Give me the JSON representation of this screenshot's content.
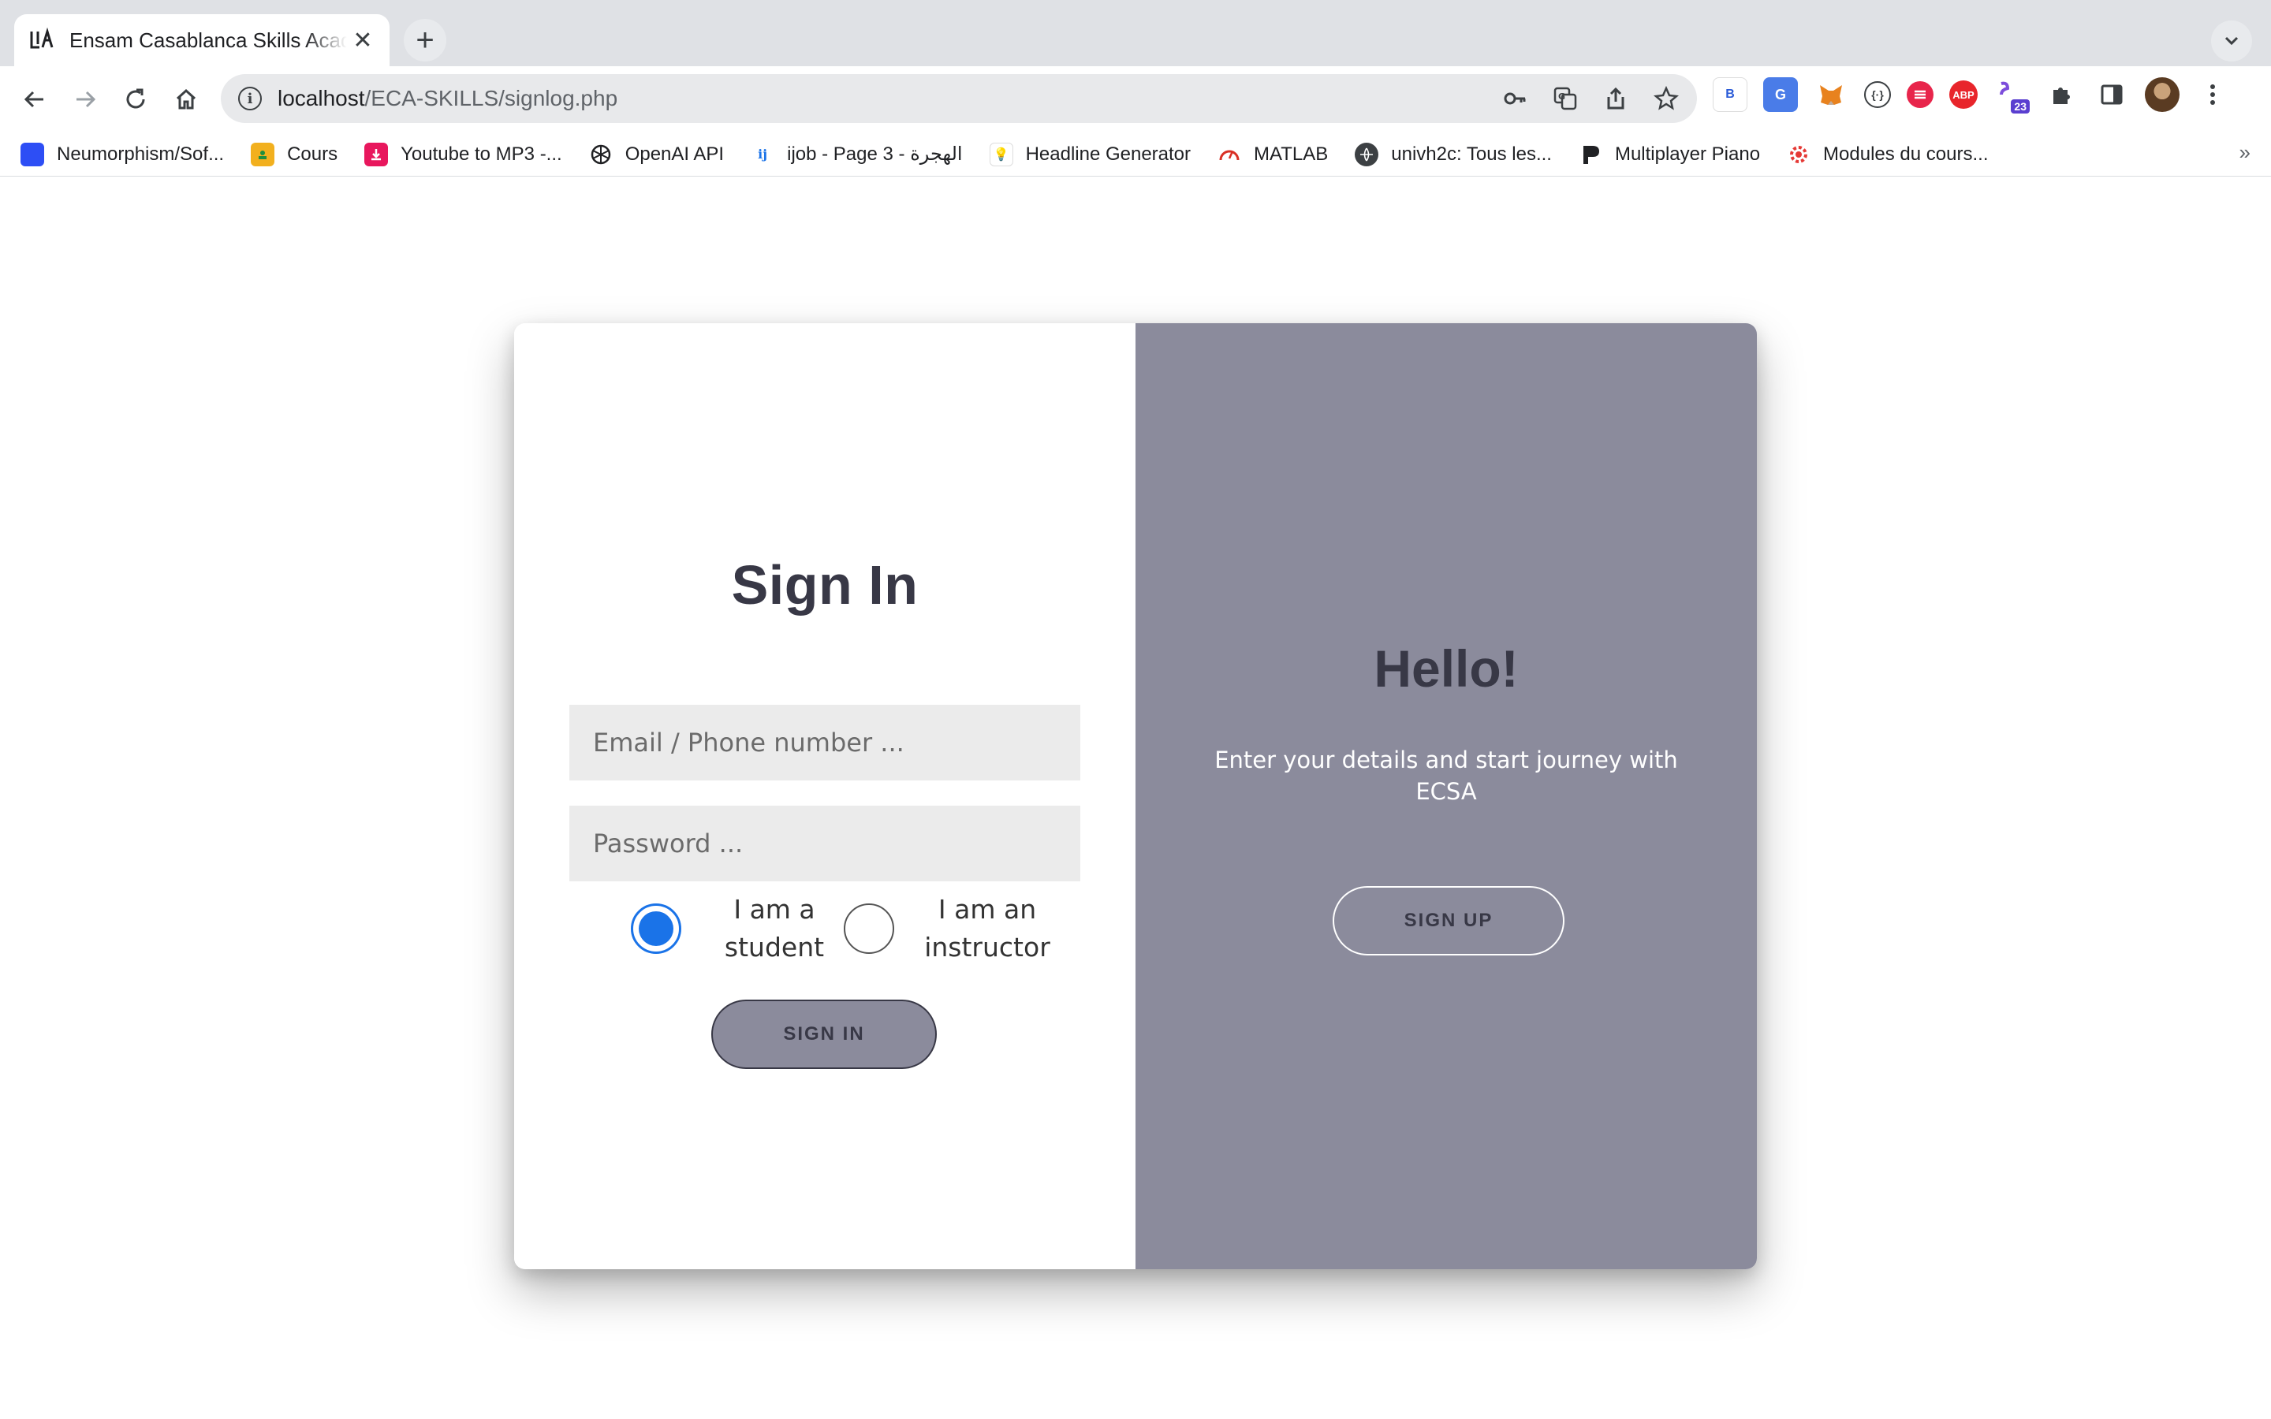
{
  "browser": {
    "tab": {
      "title": "Ensam Casablanca Skills Academy",
      "close": "✕"
    },
    "new_tab": "+",
    "url": {
      "host": "localhost",
      "path": "/ECA-SKILLS/signlog.php"
    },
    "extensions": [
      "B",
      "G",
      "fox",
      "{·}",
      "lastpass",
      "ABP",
      "23"
    ],
    "bookmarks": [
      {
        "label": "Neumorphism/Sof...",
        "icon": "square-icon",
        "color": "#2d4ef5"
      },
      {
        "label": "Cours",
        "icon": "classroom-icon",
        "color": "#f2b01e"
      },
      {
        "label": "Youtube to MP3 -...",
        "icon": "download-icon",
        "color": "#e8175d"
      },
      {
        "label": "OpenAI API",
        "icon": "openai-icon",
        "color": "#202124"
      },
      {
        "label": "ijob - Page 3 - الهجرة",
        "icon": "ij-icon",
        "color": "#1a73e8"
      },
      {
        "label": "Headline Generator",
        "icon": "bulb-icon",
        "color": "#9aa0a6"
      },
      {
        "label": "MATLAB",
        "icon": "gauge-icon",
        "color": "#d93025"
      },
      {
        "label": "univh2c: Tous les...",
        "icon": "globe-icon",
        "color": "#3c4043"
      },
      {
        "label": "Multiplayer Piano",
        "icon": "p-icon",
        "color": "#202124"
      },
      {
        "label": "Modules du cours...",
        "icon": "gear-red-icon",
        "color": "#e53935"
      }
    ],
    "more": "»"
  },
  "page": {
    "signin": {
      "title": "Sign In",
      "email_placeholder": "Email / Phone number ...",
      "password_placeholder": "Password ...",
      "role_student": "I am a student",
      "role_instructor": "I am an instructor",
      "selected_role": "student",
      "button": "SIGN IN"
    },
    "signup": {
      "title": "Hello!",
      "text": "Enter your details and start journey with ECSA",
      "button": "SIGN UP"
    }
  },
  "colors": {
    "panel": "#8b8b9c",
    "dark_text": "#383846",
    "radio_accent": "#1a73e8",
    "field_bg": "#ebebeb"
  }
}
